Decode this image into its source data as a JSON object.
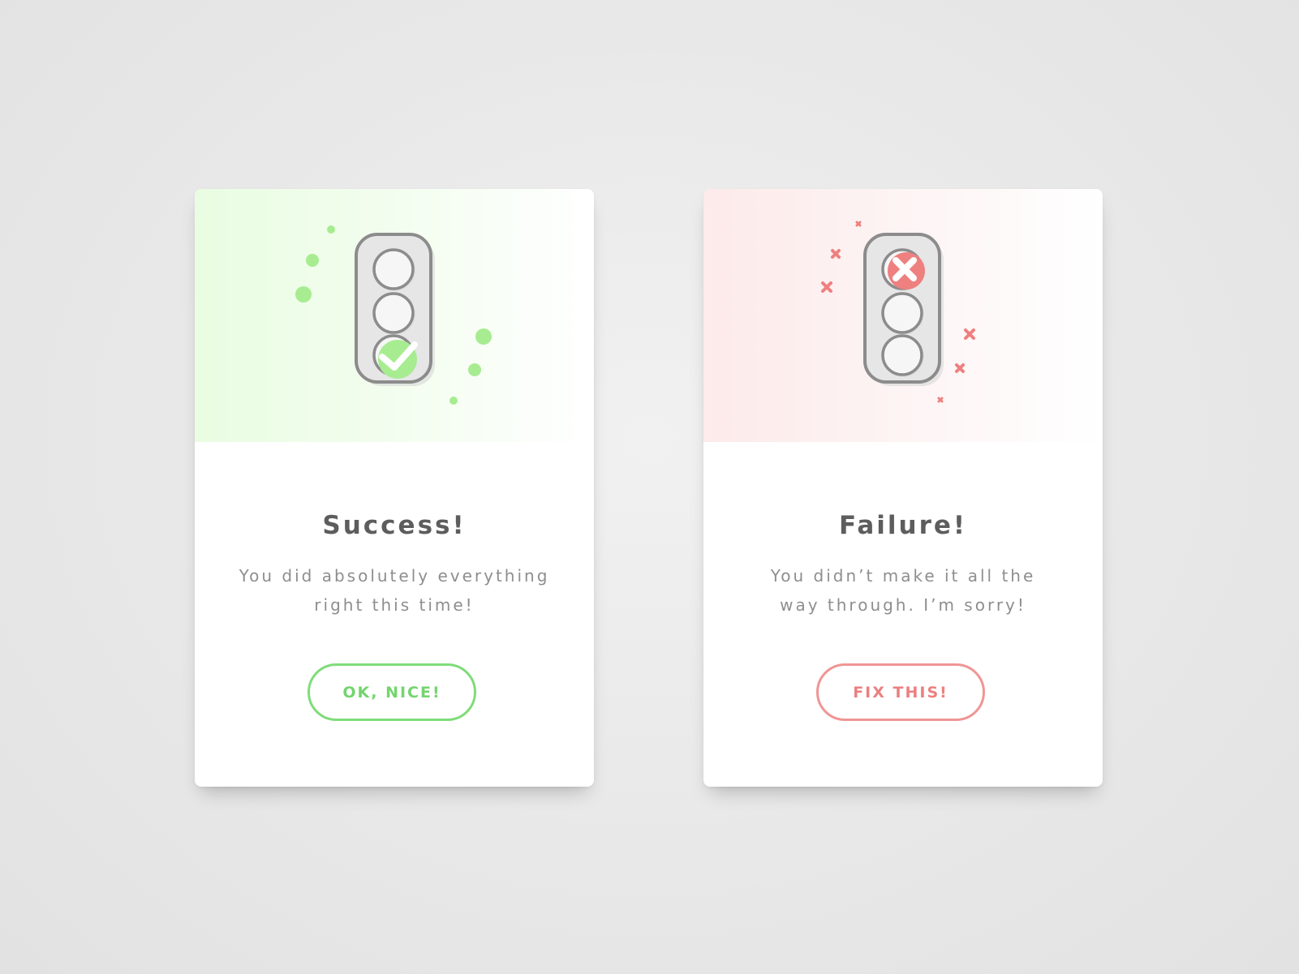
{
  "cards": {
    "success": {
      "title": "Success!",
      "message_line1": "You did absolutely everything",
      "message_line2": "right this time!",
      "button_label": "OK, NICE!",
      "accent_color": "#7fdc7a",
      "active_light": "bottom",
      "status_icon": "check-icon",
      "decoration_icon": "dot-icon"
    },
    "failure": {
      "title": "Failure!",
      "message_line1": "You didn’t make it all the",
      "message_line2": "way through. I’m sorry!",
      "button_label": "FIX THIS!",
      "accent_color": "#f09595",
      "active_light": "top",
      "status_icon": "x-icon",
      "decoration_icon": "x-icon"
    }
  }
}
